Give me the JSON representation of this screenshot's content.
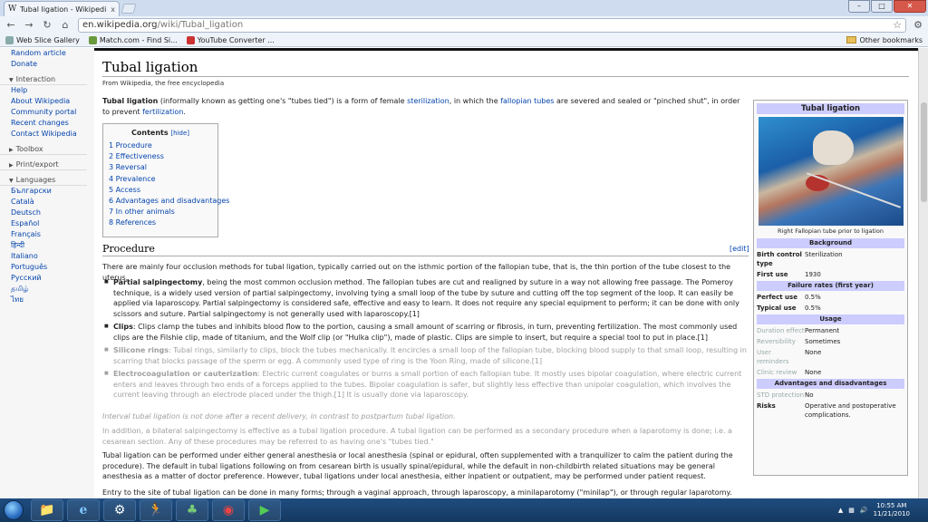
{
  "browser": {
    "tab_title": "Tubal ligation - Wikipedi...",
    "tab_close": "x",
    "url_host": "en.wikipedia.org",
    "url_path": "/wiki/Tubal_ligation",
    "bookmarks": [
      "Web Slice Gallery",
      "Match.com - Find Si...",
      "YouTube Converter ..."
    ],
    "other_bookmarks": "Other bookmarks"
  },
  "sidebar": {
    "top_items": [
      "Random article",
      "Donate"
    ],
    "interaction_header": "Interaction",
    "interaction_items": [
      "Help",
      "About Wikipedia",
      "Community portal",
      "Recent changes",
      "Contact Wikipedia"
    ],
    "toolbox_header": "Toolbox",
    "print_header": "Print/export",
    "languages_header": "Languages",
    "languages": [
      "Български",
      "Català",
      "Deutsch",
      "Español",
      "Français",
      "हिन्दी",
      "Italiano",
      "Português",
      "Русский",
      "தமிழ்",
      "ไทย"
    ]
  },
  "article": {
    "title": "Tubal ligation",
    "from": "From Wikipedia, the free encyclopedia",
    "intro": {
      "bold": "Tubal ligation",
      "t1": " (informally known as getting one's \"tubes tied\") is a form of female ",
      "l1": "sterilization",
      "t2": ", in which the ",
      "l2": "fallopian tubes",
      "t3": " are severed and sealed or \"pinched shut\", in order to prevent ",
      "l3": "fertilization",
      "t4": "."
    },
    "toc": {
      "title": "Contents",
      "hide": "[hide]",
      "entries": [
        "1 Procedure",
        "2 Effectiveness",
        "3 Reversal",
        "4 Prevalence",
        "5 Access",
        "6 Advantages and disadvantages",
        "7 In other animals",
        "8 References"
      ]
    },
    "section_title": "Procedure",
    "edit": "[edit]",
    "procedure_intro": "There are mainly four occlusion methods for tubal ligation, typically carried out on the isthmic portion of the fallopian tube, that is, the thin portion of the tube closest to the uterus.",
    "bullets": [
      {
        "term": "Partial salpingectomy",
        "text": ", being the most common occlusion method. The fallopian tubes are cut and realigned by suture in a way not allowing free passage. The Pomeroy technique, is a widely used version of partial salpingectomy, involving tying a small loop of the tube by suture and cutting off the top segment of the loop. It can easily be applied via laparoscopy. Partial salpingectomy is considered safe, effective and easy to learn. It does not require any special equipment to perform; it can be done with only scissors and suture. Partial salpingectomy is not generally used with laparoscopy.[1]"
      },
      {
        "term": "Clips",
        "text": ": Clips clamp the tubes and inhibits blood flow to the portion, causing a small amount of scarring or fibrosis, in turn, preventing fertilization. The most commonly used clips are the Filshie clip, made of titanium, and the Wolf clip (or \"Hulka clip\"), made of plastic. Clips are simple to insert, but require a special tool to put in place.[1]"
      },
      {
        "term": "Silicone rings",
        "text": ": Tubal rings, similarly to clips, block the tubes mechanically. It encircles a small loop of the fallopian tube, blocking blood supply to that small loop, resulting in scarring that blocks passage of the sperm or egg. A commonly used type of ring is the Yoon Ring, made of silicone.[1]"
      },
      {
        "term": "Electrocoagulation or cauterization",
        "text": ": Electric current coagulates or burns a small portion of each fallopian tube. It mostly uses bipolar coagulation, where electric current enters and leaves through two ends of a forceps applied to the tubes. Bipolar coagulation is safer, but slightly less effective than unipolar coagulation, which involves the current leaving through an electrode placed under the thigh.[1] It is usually done via laparoscopy."
      }
    ],
    "interval_note": "Interval tubal ligation is not done after a recent delivery, in contrast to postpartum tubal ligation.",
    "addition": "In addition, a bilateral salpingectomy is effective as a tubal ligation procedure. A tubal ligation can be performed as a secondary procedure when a laparotomy is done; i.e. a cesarean section. Any of these procedures may be referred to as having one's \"tubes tied.\"",
    "anesthesia": "Tubal ligation can be performed under either general anesthesia or local anesthesia (spinal or epidural, often supplemented with a tranquilizer to calm the patient during the procedure). The default in tubal ligations following on from cesarean birth is usually spinal/epidural, while the default in non-childbirth related situations may be general anesthesia as a matter of doctor preference. However, tubal ligations under local anesthesia, either inpatient or outpatient, may be performed under patient request.",
    "entry": "Entry to the site of tubal ligation can be done in many forms; through a vaginal approach, through laparoscopy, a minilaparotomy (\"minilap\"), or through regular laparotomy."
  },
  "infobox": {
    "title": "Tubal ligation",
    "caption": "Right Fallopian tube prior to ligation",
    "sec_background": "Background",
    "birth_control_type_k": "Birth control type",
    "birth_control_type_v": "Sterilization",
    "first_use_k": "First use",
    "first_use_v": "1930",
    "sec_failure": "Failure rates (first year)",
    "perfect_use_k": "Perfect use",
    "perfect_use_v": "0.5%",
    "typical_use_k": "Typical use",
    "typical_use_v": "0.5%",
    "sec_usage": "Usage",
    "duration_k": "Duration effect",
    "duration_v": "Permanent",
    "reversibility_k": "Reversibility",
    "reversibility_v": "Sometimes",
    "user_reminders_k": "User reminders",
    "user_reminders_v": "None",
    "clinic_review_k": "Clinic review",
    "clinic_review_v": "None",
    "sec_adv": "Advantages and disadvantages",
    "std_k": "STD protection",
    "std_v": "No",
    "risks_k": "Risks",
    "risks_v": "Operative and postoperative complications."
  },
  "taskbar": {
    "time": "10:55 AM",
    "date": "11/21/2010"
  }
}
